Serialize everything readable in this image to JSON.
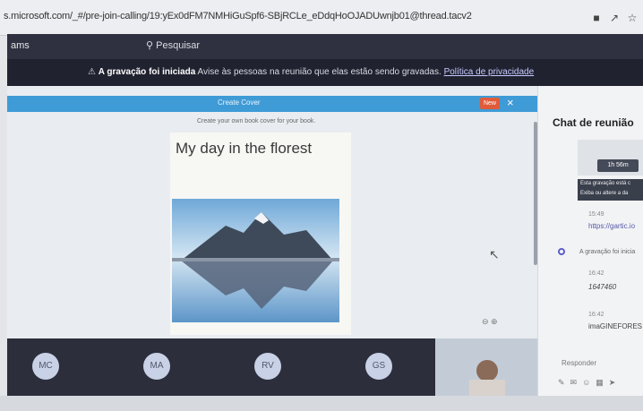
{
  "browser": {
    "url": "s.microsoft.com/_#/pre-join-calling/19:yEx0dFM7NMHiGuSpf6-SBjRCLe_eDdqHoOJADUwnjb01@thread.tacv2"
  },
  "teams": {
    "app_name": "ams",
    "search_label": "Pesquisar"
  },
  "banner": {
    "bold": "A gravação foi iniciada",
    "text": "Avise às pessoas na reunião que elas estão sendo gravadas.",
    "link": "Política de privacidade"
  },
  "modal": {
    "title": "Create Cover",
    "new_label": "New",
    "close": "×",
    "subtitle": "Create your own book cover for your book."
  },
  "cover": {
    "title": "My day in the florest"
  },
  "participants": [
    {
      "initials": "MC"
    },
    {
      "initials": "MA"
    },
    {
      "initials": "RV"
    },
    {
      "initials": "GS"
    }
  ],
  "chat": {
    "title": "Chat de reunião",
    "duration": "1h 56m",
    "recording_line1": "Esta gravação está c",
    "recording_line2": "Exiba ou altere a da",
    "messages": [
      {
        "time": "15:49",
        "text": "https://gartic.io"
      },
      {
        "time": "",
        "text": "A gravação foi inicia"
      },
      {
        "time": "16:42",
        "text": "1647460"
      },
      {
        "time": "16:42",
        "text": "imaGINEFORES"
      }
    ],
    "reply_label": "Responder"
  },
  "colors": {
    "teams_header": "#2f3140",
    "banner": "#202230",
    "modal_header": "#3f9bd6",
    "new_button": "#e05b3a",
    "accent": "#5b5fc7"
  }
}
